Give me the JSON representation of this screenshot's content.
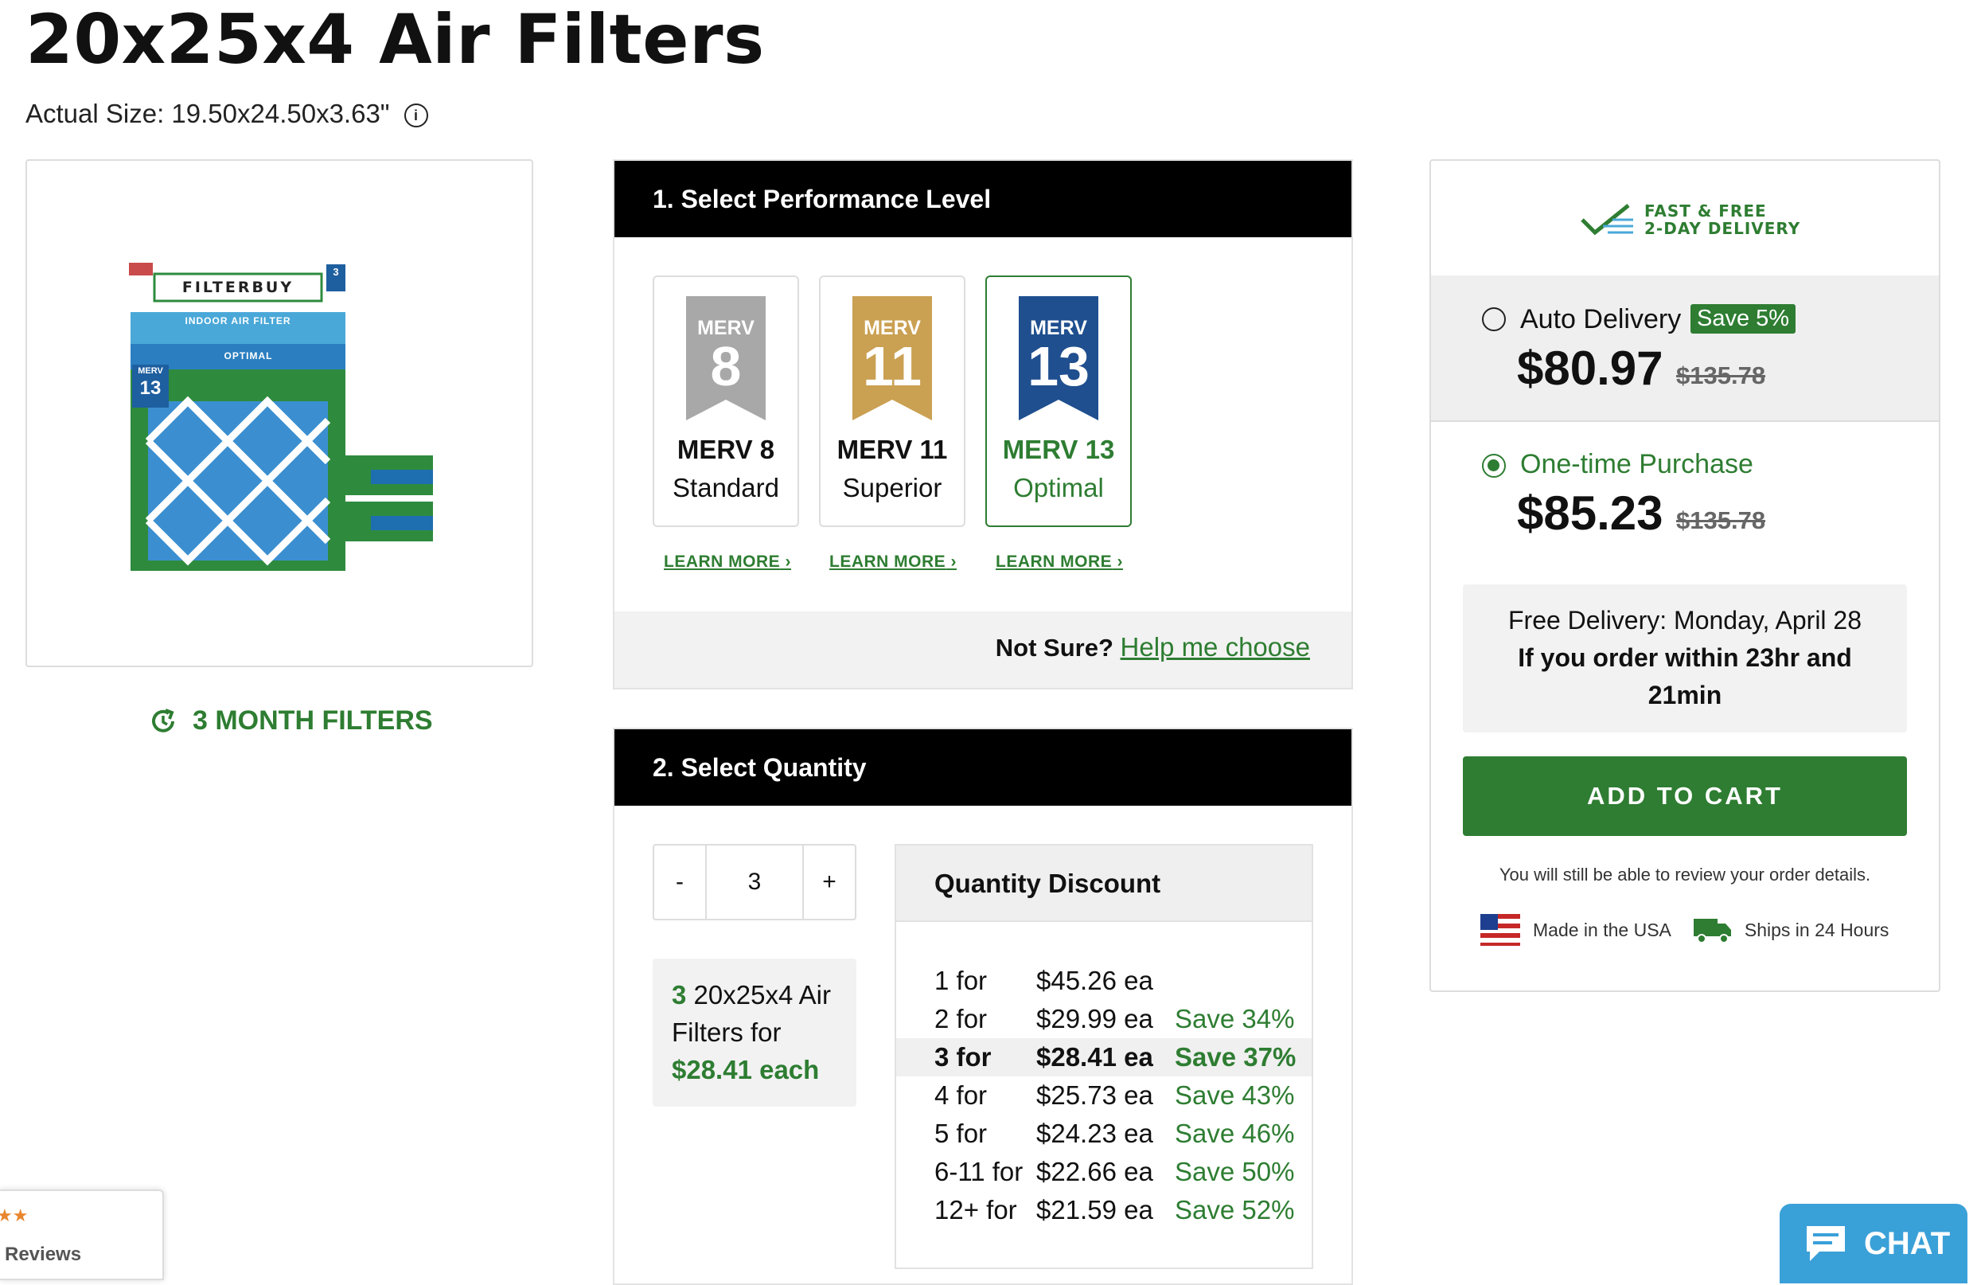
{
  "page": {
    "title": "20x25x4 Air Filters",
    "actual_size": "Actual Size: 19.50x24.50x3.63\""
  },
  "product_image": {
    "brand": "FILTERBUY",
    "pack_label": "3",
    "box_line": "INDOOR AIR FILTER",
    "box_level": "OPTIMAL",
    "merv_small": "MERV",
    "merv_num": "13"
  },
  "filter_life": {
    "label": "3 MONTH FILTERS"
  },
  "performance": {
    "heading": "1. Select Performance Level",
    "options": [
      {
        "badge_top": "MERV",
        "badge_num": "8",
        "name": "MERV 8",
        "sub": "Standard",
        "color": "#a8a8a8",
        "learn": "LEARN MORE"
      },
      {
        "badge_top": "MERV",
        "badge_num": "11",
        "name": "MERV 11",
        "sub": "Superior",
        "color": "#caa052",
        "learn": "LEARN MORE"
      },
      {
        "badge_top": "MERV",
        "badge_num": "13",
        "name": "MERV 13",
        "sub": "Optimal",
        "color": "#1f4f8f",
        "learn": "LEARN MORE"
      }
    ],
    "not_sure": "Not Sure?",
    "help_link": "Help me choose"
  },
  "quantity": {
    "heading": "2. Select Quantity",
    "minus": "-",
    "value": "3",
    "plus": "+",
    "summary_count": "3",
    "summary_text1": " 20x25x4 Air",
    "summary_text2": "Filters for",
    "summary_price": "$28.41 each",
    "discount_heading": "Quantity Discount",
    "tiers": [
      {
        "qty": "1 for",
        "price": "$45.26 ea",
        "save": ""
      },
      {
        "qty": "2 for",
        "price": "$29.99 ea",
        "save": "Save 34%"
      },
      {
        "qty": "3 for",
        "price": "$28.41 ea",
        "save": "Save 37%"
      },
      {
        "qty": "4 for",
        "price": "$25.73 ea",
        "save": "Save 43%"
      },
      {
        "qty": "5 for",
        "price": "$24.23 ea",
        "save": "Save 46%"
      },
      {
        "qty": "6-11 for",
        "price": "$22.66 ea",
        "save": "Save 50%"
      },
      {
        "qty": "12+ for",
        "price": "$21.59 ea",
        "save": "Save 52%"
      }
    ]
  },
  "purchase": {
    "delivery_badge1": "FAST & FREE",
    "delivery_badge2": "2-DAY DELIVERY",
    "auto_label": "Auto Delivery",
    "auto_save": "Save 5%",
    "auto_price": "$80.97",
    "auto_was": "$135.78",
    "once_label": "One-time Purchase",
    "once_price": "$85.23",
    "once_was": "$135.78",
    "delivery_line1": "Free Delivery: Monday, April 28",
    "delivery_line2": "If you order within 23hr and",
    "delivery_line3": "21min",
    "add_to_cart": "ADD TO CART",
    "review_note": "You will still be able to review your order details.",
    "made_usa": "Made in the USA",
    "ships": "Ships in 24 Hours"
  },
  "widgets": {
    "chat": "CHAT",
    "reviews_text": "Reviews"
  },
  "colors": {
    "brand_green": "#2e7d32",
    "chat_blue": "#3aa0d8"
  }
}
